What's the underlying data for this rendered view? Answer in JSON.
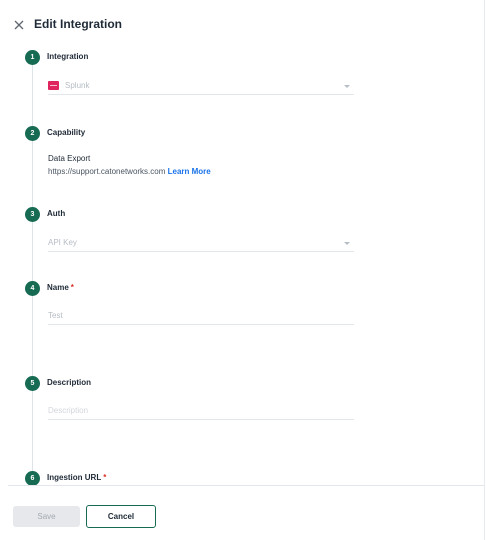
{
  "header": {
    "close_icon": "close-icon",
    "title": "Edit Integration"
  },
  "steps": [
    {
      "number": "1",
      "label": "Integration"
    },
    {
      "number": "2",
      "label": "Capability"
    },
    {
      "number": "3",
      "label": "Auth"
    },
    {
      "number": "4",
      "label": "Name",
      "required": "*"
    },
    {
      "number": "5",
      "label": "Description"
    },
    {
      "number": "6",
      "label": "Ingestion URL",
      "required": "*"
    }
  ],
  "integration": {
    "selected_value": "Splunk",
    "logo_icon": "splunk-logo-icon"
  },
  "capability": {
    "title": "Data Export",
    "url": "https://support.catonetworks.com",
    "link_label": "Learn More"
  },
  "auth": {
    "selected_value": "API Key"
  },
  "name": {
    "value": "Test"
  },
  "description": {
    "placeholder": "Description"
  },
  "footer": {
    "save_label": "Save",
    "cancel_label": "Cancel"
  },
  "colors": {
    "accent": "#176b53",
    "required": "#d93025",
    "link": "#1a73e8"
  }
}
